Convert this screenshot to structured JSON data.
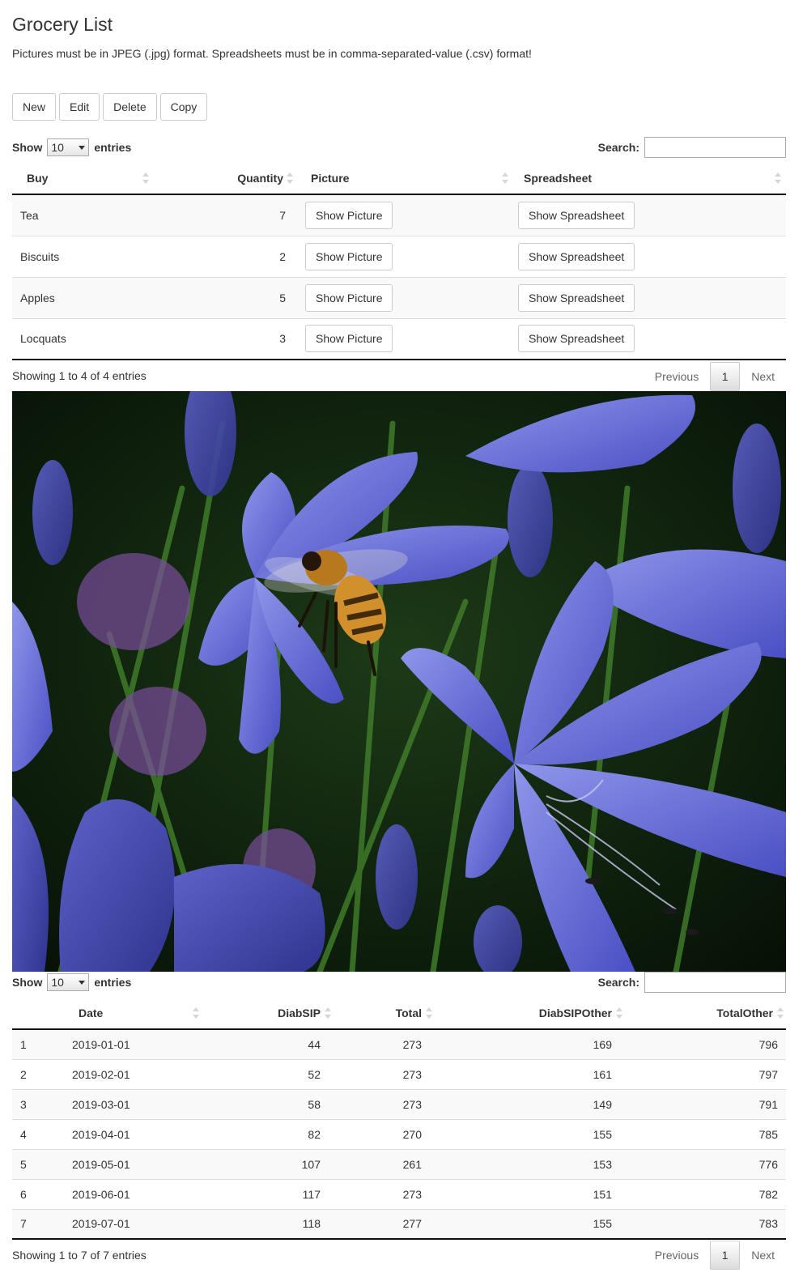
{
  "header": {
    "title": "Grocery List",
    "note": "Pictures must be in JPEG (.jpg) format. Spreadsheets must be in comma-separated-value (.csv) format!"
  },
  "toolbar": {
    "new_label": "New",
    "edit_label": "Edit",
    "delete_label": "Delete",
    "copy_label": "Copy"
  },
  "grocery_table": {
    "show_label": "Show",
    "page_size": "10",
    "entries_label": "entries",
    "search_label": "Search:",
    "columns": [
      "Buy",
      "Quantity",
      "Picture",
      "Spreadsheet"
    ],
    "rows": [
      {
        "buy": "Tea",
        "quantity": "7",
        "picture_btn": "Show Picture",
        "sheet_btn": "Show Spreadsheet"
      },
      {
        "buy": "Biscuits",
        "quantity": "2",
        "picture_btn": "Show Picture",
        "sheet_btn": "Show Spreadsheet"
      },
      {
        "buy": "Apples",
        "quantity": "5",
        "picture_btn": "Show Picture",
        "sheet_btn": "Show Spreadsheet"
      },
      {
        "buy": "Locquats",
        "quantity": "3",
        "picture_btn": "Show Picture",
        "sheet_btn": "Show Spreadsheet"
      }
    ],
    "info": "Showing 1 to 4 of 4 entries",
    "pager": {
      "previous": "Previous",
      "current": "1",
      "next": "Next"
    }
  },
  "photo": {
    "subject": "honeybee on blue agapanthus flowers"
  },
  "data_table": {
    "show_label": "Show",
    "page_size": "10",
    "entries_label": "entries",
    "search_label": "Search:",
    "columns": [
      "",
      "Date",
      "DiabSIP",
      "Total",
      "DiabSIPOther",
      "TotalOther"
    ],
    "rows": [
      [
        "1",
        "2019-01-01",
        "44",
        "273",
        "169",
        "796"
      ],
      [
        "2",
        "2019-02-01",
        "52",
        "273",
        "161",
        "797"
      ],
      [
        "3",
        "2019-03-01",
        "58",
        "273",
        "149",
        "791"
      ],
      [
        "4",
        "2019-04-01",
        "82",
        "270",
        "155",
        "785"
      ],
      [
        "5",
        "2019-05-01",
        "107",
        "261",
        "153",
        "776"
      ],
      [
        "6",
        "2019-06-01",
        "117",
        "273",
        "151",
        "782"
      ],
      [
        "7",
        "2019-07-01",
        "118",
        "277",
        "155",
        "783"
      ]
    ],
    "info": "Showing 1 to 7 of 7 entries",
    "pager": {
      "previous": "Previous",
      "current": "1",
      "next": "Next"
    }
  }
}
